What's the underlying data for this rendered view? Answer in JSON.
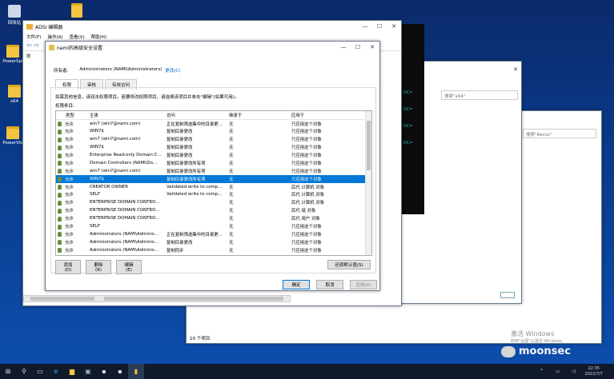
{
  "desktop_icons": [
    {
      "label": "回收站"
    },
    {
      "label": "PowerSpl"
    },
    {
      "label": "x64"
    },
    {
      "label": "PowerVie"
    }
  ],
  "adsi": {
    "title": "ADSI 编辑器",
    "menu": [
      "文件(F)",
      "操作(A)",
      "查看(V)",
      "帮助(H)"
    ],
    "panel_label": "数"
  },
  "terminal": {
    "lines": [
      "DC=",
      "DC=",
      "DC=",
      "DC="
    ]
  },
  "explorer1": {
    "search_placeholder": "搜索\"x64\""
  },
  "explorer2": {
    "search_placeholder": "搜索\"Recon\"",
    "status": "10 个项目"
  },
  "dialog": {
    "title": "nami的高级安全设置",
    "owner_label": "所有者:",
    "owner_value": "Administrators (NAMI\\Administrators)",
    "owner_change": "更改(C)",
    "tabs": [
      "权限",
      "审核",
      "有效访问"
    ],
    "info": "如需其他信息，请双击权限项目。若要修改权限项目，请选择该项目并单击\"编辑\"(如果可用)。",
    "entries_label": "权限条目:",
    "columns": [
      "类型",
      "主体",
      "访问",
      "继承于",
      "应用于"
    ],
    "rows": [
      [
        "允许",
        "win7 (win7@nami.com)",
        "正在复制筛选集中的目录更...",
        "无",
        "只应用这个对象"
      ],
      [
        "允许",
        "WIN7$",
        "复制目录更改",
        "无",
        "只应用这个对象"
      ],
      [
        "允许",
        "win7 (win7@nami.com)",
        "复制目录更改",
        "无",
        "只应用这个对象"
      ],
      [
        "允许",
        "WIN7$",
        "复制目录更改",
        "无",
        "只应用这个对象"
      ],
      [
        "允许",
        "Enterprise Read-only Domain C...",
        "复制目录更改",
        "无",
        "只应用这个对象"
      ],
      [
        "允许",
        "Domain Controllers (NAMI\\Do...",
        "复制目录更改所有项",
        "无",
        "只应用这个对象"
      ],
      [
        "允许",
        "win7 (win7@nami.com)",
        "复制目录更改所有项",
        "无",
        "只应用这个对象"
      ],
      [
        "允许",
        "WIN7$",
        "复制目录更改所有项",
        "无",
        "只应用这个对象"
      ],
      [
        "允许",
        "CREATOR OWNER",
        "Validated write to comp...",
        "无",
        "后代 计算机 对象"
      ],
      [
        "允许",
        "SELF",
        "Validated write to comp...",
        "无",
        "后代 计算机 对象"
      ],
      [
        "允许",
        "ENTERPRISE DOMAIN CONTRO...",
        "",
        "无",
        "后代 计算机 对象"
      ],
      [
        "允许",
        "ENTERPRISE DOMAIN CONTRO...",
        "",
        "无",
        "后代 组 对象"
      ],
      [
        "允许",
        "ENTERPRISE DOMAIN CONTRO...",
        "",
        "无",
        "后代 用户 对象"
      ],
      [
        "允许",
        "SELF",
        "",
        "无",
        "只应用这个对象"
      ],
      [
        "允许",
        "Administrators (NAMI\\Adminis...",
        "正在复制筛选集中的目录更...",
        "无",
        "只应用这个对象"
      ],
      [
        "允许",
        "Administrators (NAMI\\Adminis...",
        "复制目录更改",
        "无",
        "只应用这个对象"
      ],
      [
        "允许",
        "Administrators (NAMI\\Adminis...",
        "复制同步",
        "无",
        "只应用这个对象"
      ]
    ],
    "selected_row": 7,
    "buttons": {
      "add": "添加(D)",
      "remove": "删除(R)",
      "edit": "编辑(E)",
      "restore": "还原默认值(S)",
      "ok": "确定",
      "cancel": "取消",
      "apply": "应用(A)"
    }
  },
  "watermark": {
    "line1": "激活 Windows",
    "line2": "转到\"设置\"以激活 Windows。"
  },
  "brand": "moonsec",
  "clock": {
    "time": "22:35",
    "date": "2022/7/7"
  }
}
